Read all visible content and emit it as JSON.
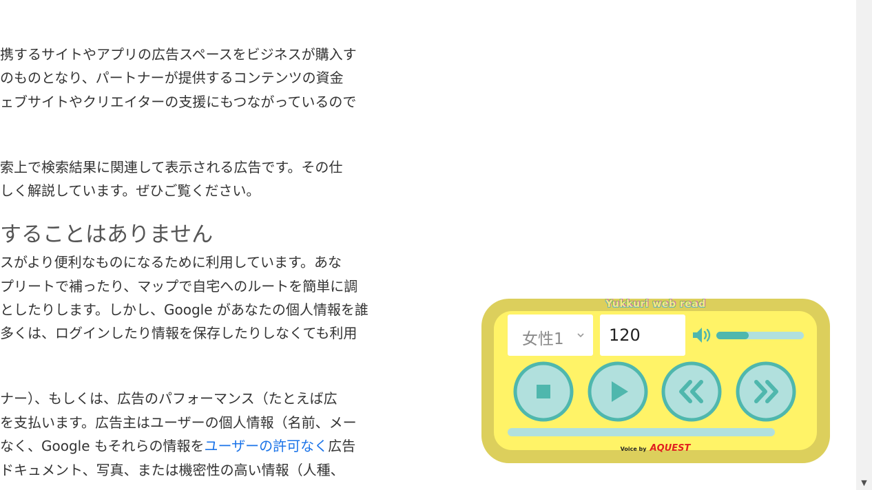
{
  "article": {
    "lines": [
      "携するサイトやアプリの広告スペースをビジネスが購入す",
      "のものとなり、パートナーが提供するコンテンツの資金",
      "ェブサイトやクリエイターの支援にもつながっているので",
      "索上で検索結果に関連して表示される広告です。その仕",
      "しく解説しています。ぜひご覧ください。",
      "スがより便利なものになるために利用しています。あな",
      "プリートで補ったり、マップで自宅へのルートを簡単に調",
      "としたりします。しかし、Google があなたの個人情報を誰",
      "多くは、ログインしたり情報を保存したりしなくても利用",
      "ナー）、もしくは、広告のパフォーマンス（たとえば広",
      "を支払います。広告主はユーザーの個人情報（名前、メー",
      "ドキュメント、写真、または機密性の高い情報（人種、"
    ],
    "heading": "することはありません",
    "line_with_link": {
      "before": "なく、Google もそれらの情報を",
      "link": "ユーザーの許可なく",
      "after": "広告"
    }
  },
  "reader": {
    "title": "Yukkuri web read",
    "voice": "女性1",
    "speed": "120",
    "volume_fraction": 0.37,
    "progress_fraction": 0.0,
    "credit_prefix": "Voice by",
    "credit_brand": "AQUEST",
    "colors": {
      "outer": "#dccf5c",
      "inner": "#fff367",
      "button_fill": "#b1e0dd",
      "button_ring": "#4fb7ad"
    },
    "buttons": [
      "stop-icon",
      "play-icon",
      "rewind-icon",
      "fast-forward-icon"
    ]
  },
  "scrollbar": {
    "down_arrow": "▼"
  }
}
